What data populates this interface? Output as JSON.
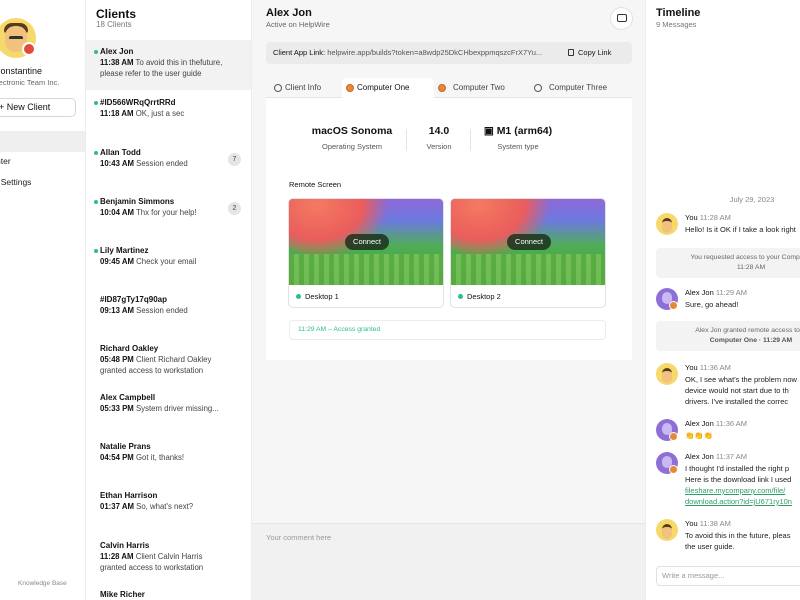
{
  "nav": {
    "user_name": "Constantine",
    "org": "Electronic Team Inc.",
    "new_client_label": "+ New Client",
    "items": [
      {
        "label": "nter"
      },
      {
        "label": "t Settings"
      }
    ],
    "knowledge_base": "Knowledge Base"
  },
  "clients": {
    "title": "Clients",
    "count": "18 Clients",
    "list": [
      {
        "name": "Alex Jon",
        "time": "11:38 AM",
        "text": "To avoid this in thefuture,",
        "text2": "please refer to the user guide",
        "online": true,
        "selected": true
      },
      {
        "name": "#ID566WRqQrrtRRd",
        "time": "11:18 AM",
        "text": "OK, just a sec",
        "online": true
      },
      {
        "name": "Allan Todd",
        "time": "10:43 AM",
        "text": "Session ended",
        "online": true,
        "unread": "7"
      },
      {
        "name": "Benjamin Simmons",
        "time": "10:04 AM",
        "text": "Thx for your help!",
        "online": true,
        "unread": "2"
      },
      {
        "name": "Lily Martinez",
        "time": "09:45 AM",
        "text": "Check your email",
        "online": true
      },
      {
        "name": "#ID87gTy17q90ap",
        "time": "09:13 AM",
        "text": "Session ended",
        "online": false
      },
      {
        "name": "Richard Oakley",
        "time": "05:48 PM",
        "text": "Client Richard Oakley",
        "text2": "granted access to workstation",
        "online": false
      },
      {
        "name": "Alex Campbell",
        "time": "05:33 PM",
        "text": "System driver missing...",
        "online": false
      },
      {
        "name": "Natalie Prans",
        "time": "04:54 PM",
        "text": "Got it, thanks!",
        "online": false
      },
      {
        "name": "Ethan Harrison",
        "time": "01:37 AM",
        "text": "So, what's next?",
        "online": false
      },
      {
        "name": "Calvin Harris",
        "time": "11:28 AM",
        "text": "Client Calvin Harris",
        "text2": "granted access to workstation",
        "online": false
      },
      {
        "name": "Mike Richer",
        "time": "",
        "text": "",
        "online": false
      }
    ]
  },
  "main": {
    "client_name": "Alex Jon",
    "status": "Active on HelpWire",
    "link_label": "Client App Link:",
    "link_url": "helpwire.app/builds?token=a8wdp25DkCHbexppmqszcFrX7Yu...",
    "copy_label": "Copy Link",
    "tabs": [
      {
        "label": "Client Info",
        "icon": "user-icon"
      },
      {
        "label": "Computer One",
        "icon": "computer-icon",
        "active": true
      },
      {
        "label": "Computer Two",
        "icon": "computer-icon"
      },
      {
        "label": "Computer Three",
        "icon": "computer-icon"
      }
    ],
    "specs": [
      {
        "value": "macOS Sonoma",
        "key": "Operating System",
        "icon": "apple-icon"
      },
      {
        "value": "14.0",
        "key": "Version"
      },
      {
        "value": "M1 (arm64)",
        "key": "System type",
        "icon": "chip-icon"
      }
    ],
    "remote_title": "Remote Screen",
    "screens": [
      {
        "label": "Desktop 1",
        "connect": "Connect"
      },
      {
        "label": "Desktop 2",
        "connect": "Connect"
      }
    ],
    "access_text": "11:29 AM – Access granted",
    "comment_placeholder": "Your comment here"
  },
  "timeline": {
    "title": "Timeline",
    "count": "9 Messages",
    "date": "July 29, 2023",
    "input_placeholder": "Write a message...",
    "messages": [
      {
        "who": "You",
        "time": "11:28 AM",
        "text": "Hello! Is it OK if I take a look right"
      },
      {
        "sys": "You requested access to your Computer",
        "sys2": "11:28 AM"
      },
      {
        "who": "Alex Jon",
        "time": "11:29 AM",
        "text": "Sure, go ahead!"
      },
      {
        "sys": "Alex Jon granted remote access to w",
        "sys2": "Computer One · 11:29 AM"
      },
      {
        "who": "You",
        "time": "11:36 AM",
        "text": "OK, I see what's the problem now",
        "text2": "device would not start due to th",
        "text3": "drivers. I've installed the correc"
      },
      {
        "who": "Alex Jon",
        "time": "11:36 AM",
        "text": "👏👏👏"
      },
      {
        "who": "Alex Jon",
        "time": "11:37 AM",
        "text": "I thought I'd installed the right p",
        "text2": "Here is the download link I used",
        "link": "fileshare.mycompany.com/file/",
        "link2": "download.action?id=jU671ry10n"
      },
      {
        "who": "You",
        "time": "11:38 AM",
        "text": "To avoid this in the future, pleas",
        "text2": "the user guide."
      }
    ]
  }
}
